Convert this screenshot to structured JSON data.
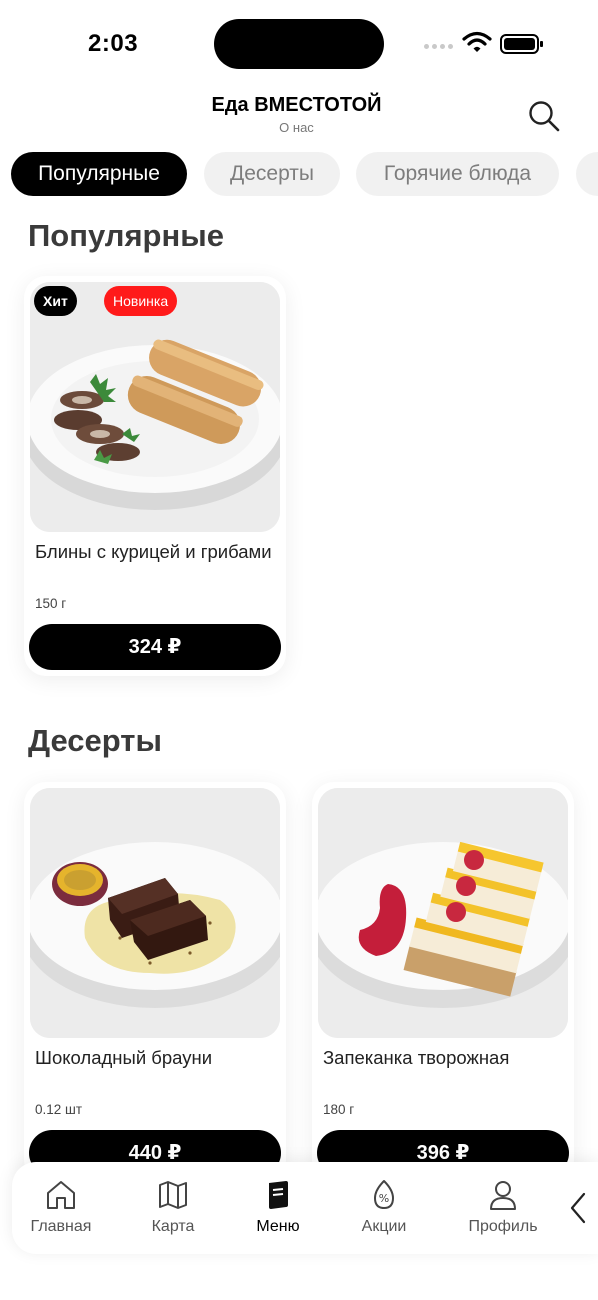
{
  "status_bar": {
    "time": "2:03"
  },
  "header": {
    "title": "Еда ВМЕСТОТОЙ",
    "subtitle": "О нас"
  },
  "tabs": [
    {
      "label": "Популярные",
      "active": true
    },
    {
      "label": "Десерты",
      "active": false
    },
    {
      "label": "Горячие блюда",
      "active": false
    }
  ],
  "sections": [
    {
      "title": "Популярные",
      "items": [
        {
          "name": "Блины с курицей и грибами",
          "weight": "150 г",
          "price": "324 ₽",
          "badges": [
            "Хит",
            "Новинка"
          ]
        }
      ]
    },
    {
      "title": "Десерты",
      "items": [
        {
          "name": "Шоколадный брауни",
          "weight": "0.12 шт",
          "price": "440 ₽"
        },
        {
          "name": "Запеканка творожная",
          "weight": "180 г",
          "price": "396 ₽"
        }
      ]
    }
  ],
  "bottom_nav": [
    {
      "label": "Главная",
      "icon": "home-icon"
    },
    {
      "label": "Карта",
      "icon": "map-icon"
    },
    {
      "label": "Меню",
      "icon": "menu-icon",
      "active": true
    },
    {
      "label": "Акции",
      "icon": "discount-icon"
    },
    {
      "label": "Профиль",
      "icon": "profile-icon"
    }
  ],
  "colors": {
    "accent": "#000000",
    "badge_new": "#ff1a1a",
    "tab_inactive_bg": "#f1f1f1"
  }
}
